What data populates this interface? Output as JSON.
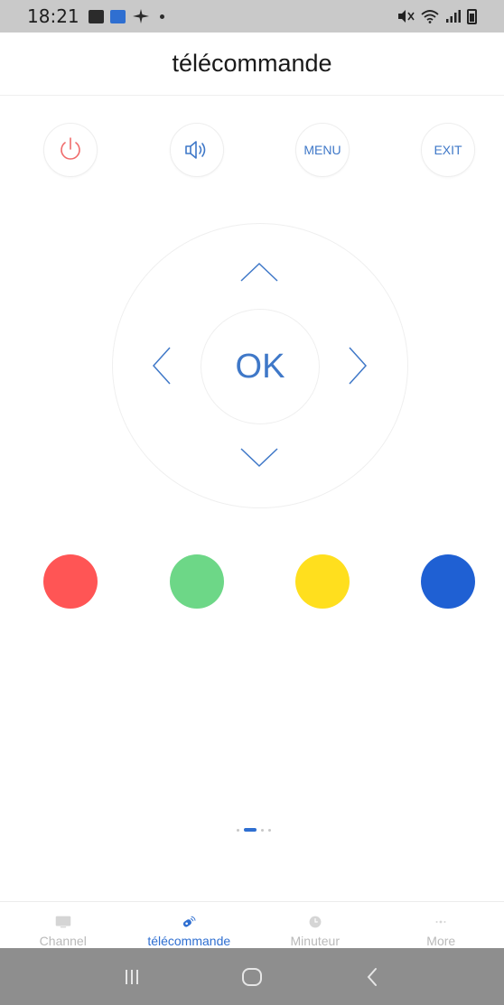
{
  "status_bar": {
    "time": "18:21",
    "left_icons": [
      "gallery-icon",
      "screen-mirror-icon",
      "airplane-icon"
    ],
    "right_icons": [
      "mute-icon",
      "wifi-icon",
      "signal-icon",
      "battery-icon"
    ]
  },
  "header": {
    "title": "télécommande"
  },
  "top_buttons": {
    "power": {
      "icon": "power-icon",
      "color": "#f06a6a"
    },
    "sound": {
      "icon": "speaker-icon",
      "color": "#3f78c8"
    },
    "menu": {
      "label": "MENU"
    },
    "exit": {
      "label": "EXIT"
    }
  },
  "dpad": {
    "ok_label": "OK",
    "arrows": [
      "chevron-up-icon",
      "chevron-left-icon",
      "chevron-right-icon",
      "chevron-down-icon"
    ],
    "accent": "#3f78c8"
  },
  "color_buttons": [
    {
      "name": "red",
      "color": "#ff5555"
    },
    {
      "name": "green",
      "color": "#6dd787"
    },
    {
      "name": "yellow",
      "color": "#ffdf1e"
    },
    {
      "name": "blue",
      "color": "#1f60d3"
    }
  ],
  "pager": {
    "pages": 4,
    "active": 1
  },
  "tabs": [
    {
      "label": "Channel",
      "icon": "tv-icon",
      "active": false
    },
    {
      "label": "télécommande",
      "icon": "remote-icon",
      "active": true
    },
    {
      "label": "Minuteur",
      "icon": "clock-icon",
      "active": false
    },
    {
      "label": "More",
      "icon": "more-icon",
      "active": false
    }
  ],
  "nav_bar": {
    "buttons": [
      "recent-apps-icon",
      "home-icon",
      "back-icon"
    ]
  },
  "colors": {
    "accent": "#2f6fd1",
    "inactive": "#b9b9b9"
  }
}
